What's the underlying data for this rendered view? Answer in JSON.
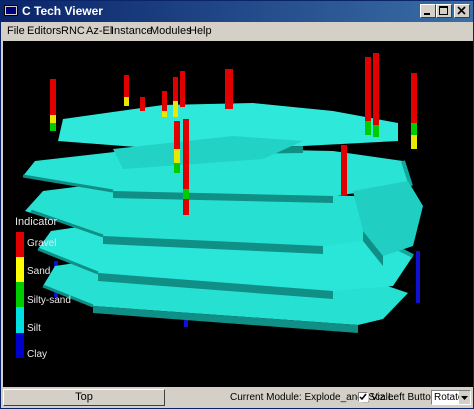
{
  "window": {
    "title": "C Tech Viewer",
    "title_colors": {
      "active_start": "#0a246a",
      "active_end": "#3a6ea5"
    }
  },
  "titlebar_buttons": [
    "minimize-icon",
    "maximize-icon",
    "close-icon"
  ],
  "menu": {
    "items": [
      "File",
      "Editors",
      "RNC",
      "Az-El",
      "Instance",
      "Modules",
      "Help"
    ]
  },
  "legend": {
    "title": "Indicator",
    "entries": [
      {
        "label": "Gravel",
        "color": "#e00000"
      },
      {
        "label": "Sand",
        "color": "#ffff00"
      },
      {
        "label": "Silty-sand",
        "color": "#00cc00"
      },
      {
        "label": "Silt",
        "color": "#00e0e0"
      },
      {
        "label": "Clay",
        "color": "#0000cc"
      }
    ]
  },
  "scene": {
    "background": "#000000",
    "layer_color": "#26e0d2",
    "layer_shadow": "#0f8f86"
  },
  "status": {
    "top_button": "Top",
    "current_module": "Current Module: Explode_and_Scale",
    "viz_label": "Viz",
    "viz_checked": true,
    "left_button_label": "Left Button",
    "left_button_mode": "Rotate"
  }
}
